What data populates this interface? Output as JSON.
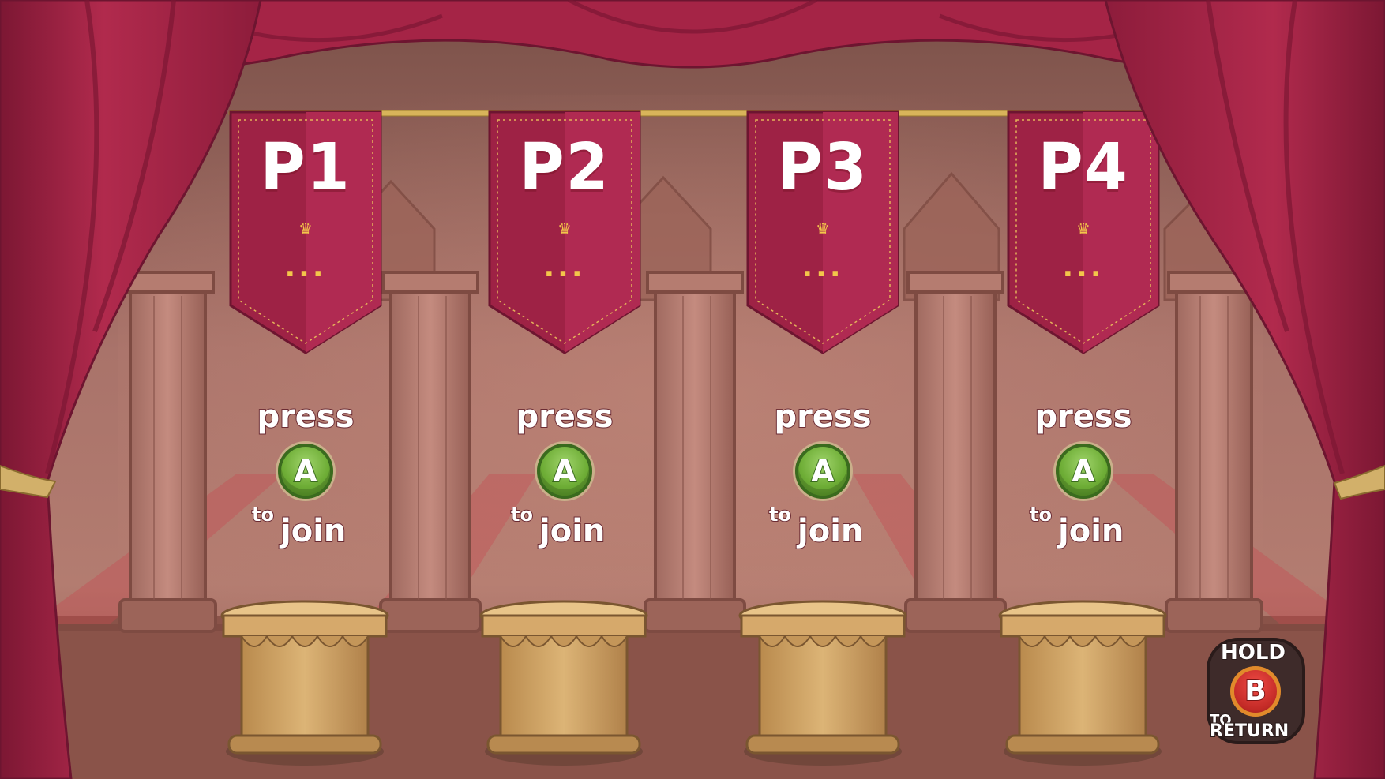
{
  "colors": {
    "curtain": "#a52446",
    "curtain_dark": "#7c1733",
    "banner": "#9e2245",
    "banner_light": "#b02a52",
    "gold": "#f3c64a",
    "wall": "#a76a5e",
    "floor": "#8a5349",
    "pedestal": "#d4a869",
    "a_button": "#6fae37",
    "b_button": "#c22a26"
  },
  "slots": [
    {
      "label": "P1",
      "crown_icon": "crown-icon",
      "name": "...",
      "press": "press",
      "button": "A",
      "to": "to",
      "join": "join"
    },
    {
      "label": "P2",
      "crown_icon": "crown-icon",
      "name": "...",
      "press": "press",
      "button": "A",
      "to": "to",
      "join": "join"
    },
    {
      "label": "P3",
      "crown_icon": "crown-icon",
      "name": "...",
      "press": "press",
      "button": "A",
      "to": "to",
      "join": "join"
    },
    {
      "label": "P4",
      "crown_icon": "crown-icon",
      "name": "...",
      "press": "press",
      "button": "A",
      "to": "to",
      "join": "join"
    }
  ],
  "return_prompt": {
    "hold": "HOLD",
    "button": "B",
    "to": "TO",
    "return": "RETURN"
  }
}
